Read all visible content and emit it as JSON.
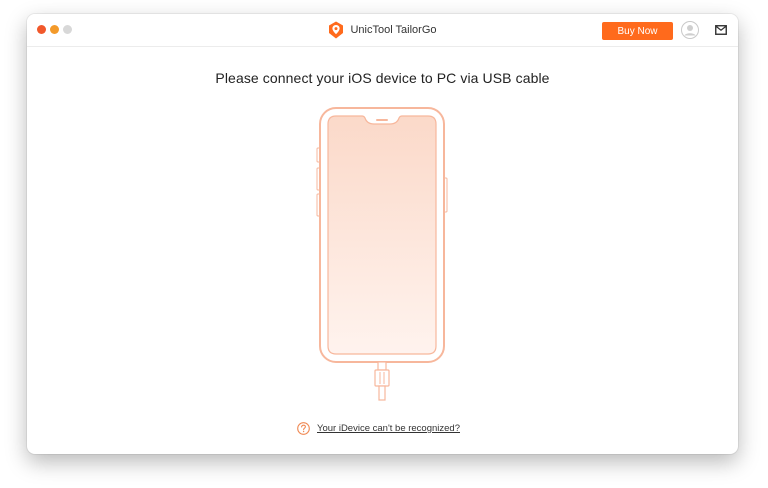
{
  "window": {
    "title": "UnicTool TailorGo",
    "buy_label": "Buy Now"
  },
  "main": {
    "headline": "Please connect your iOS device to PC via USB cable",
    "help_link": "Your iDevice can't be recognized?"
  },
  "icons": {
    "logo": "unictool-logo-icon",
    "avatar": "user-avatar-icon",
    "mail": "mail-icon",
    "help": "question-circle-icon",
    "phone": "phone-illustration",
    "cable": "usb-cable-icon"
  },
  "colors": {
    "accent": "#ff6a1c",
    "phone_outline": "#f7b79c",
    "phone_fill": "#fde4d8"
  }
}
